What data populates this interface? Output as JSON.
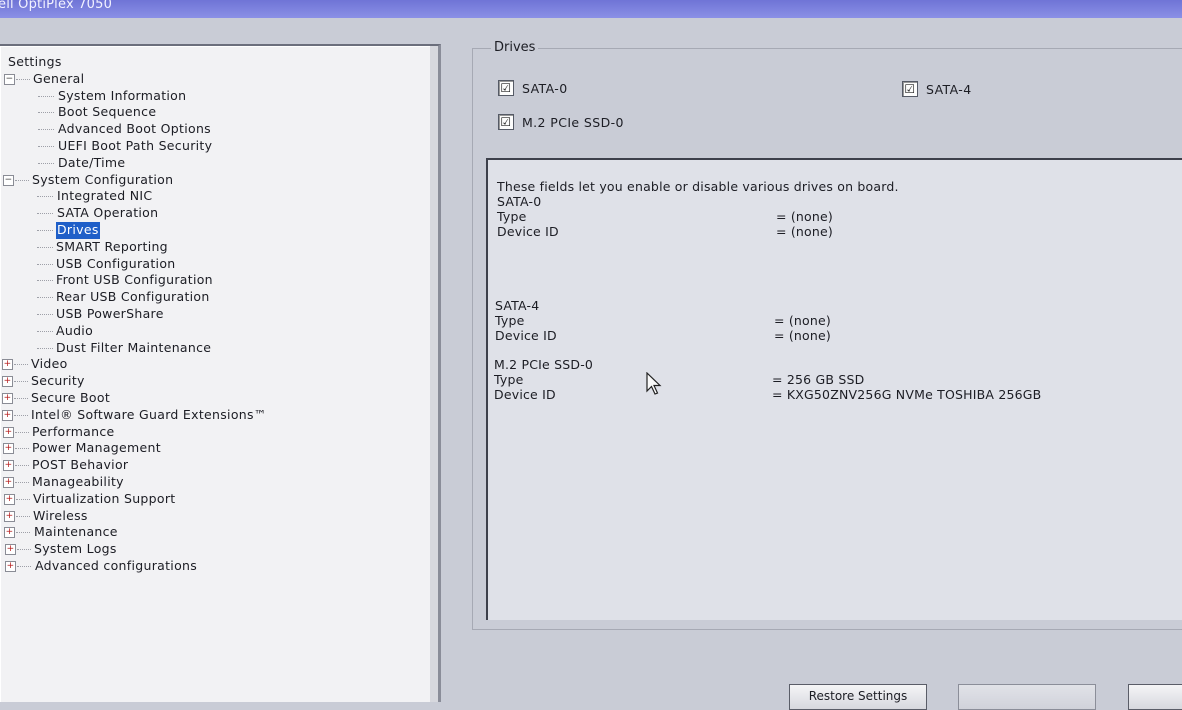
{
  "window": {
    "title": "ell OptiPlex 7050"
  },
  "tree": {
    "root": "Settings",
    "general": {
      "label": "General",
      "items": [
        "System Information",
        "Boot Sequence",
        "Advanced Boot Options",
        "UEFI Boot Path Security",
        "Date/Time"
      ]
    },
    "system_configuration": {
      "label": "System Configuration",
      "items": [
        "Integrated NIC",
        "SATA Operation",
        "Drives",
        "SMART Reporting",
        "USB Configuration",
        "Front USB Configuration",
        "Rear USB Configuration",
        "USB PowerShare",
        "Audio",
        "Dust Filter Maintenance"
      ],
      "selected": "Drives"
    },
    "collapsed": [
      "Video",
      "Security",
      "Secure Boot",
      "Intel® Software Guard Extensions™",
      "Performance",
      "Power Management",
      "POST Behavior",
      "Manageability",
      "Virtualization Support",
      "Wireless",
      "Maintenance",
      "System Logs",
      "Advanced configurations"
    ]
  },
  "drives": {
    "group_title": "Drives",
    "checkboxes": [
      {
        "label": "SATA-0",
        "checked": true
      },
      {
        "label": "SATA-4",
        "checked": true
      },
      {
        "label": "M.2 PCIe SSD-0",
        "checked": true
      }
    ],
    "check_glyph": "☑"
  },
  "info": {
    "intro": "These fields let you enable or disable various drives on board.",
    "sections": [
      {
        "name": "SATA-0",
        "type_label": "Type",
        "type_value": "= (none)",
        "id_label": "Device ID",
        "id_value": "= (none)"
      },
      {
        "name": "SATA-4",
        "type_label": "Type",
        "type_value": "= (none)",
        "id_label": "Device ID",
        "id_value": "= (none)"
      },
      {
        "name": "M.2 PCIe SSD-0",
        "type_label": "Type",
        "type_value": "= 256 GB SSD",
        "id_label": "Device ID",
        "id_value": "= KXG50ZNV256G NVMe TOSHIBA 256GB"
      }
    ]
  },
  "buttons": {
    "restore": "Restore Settings"
  }
}
